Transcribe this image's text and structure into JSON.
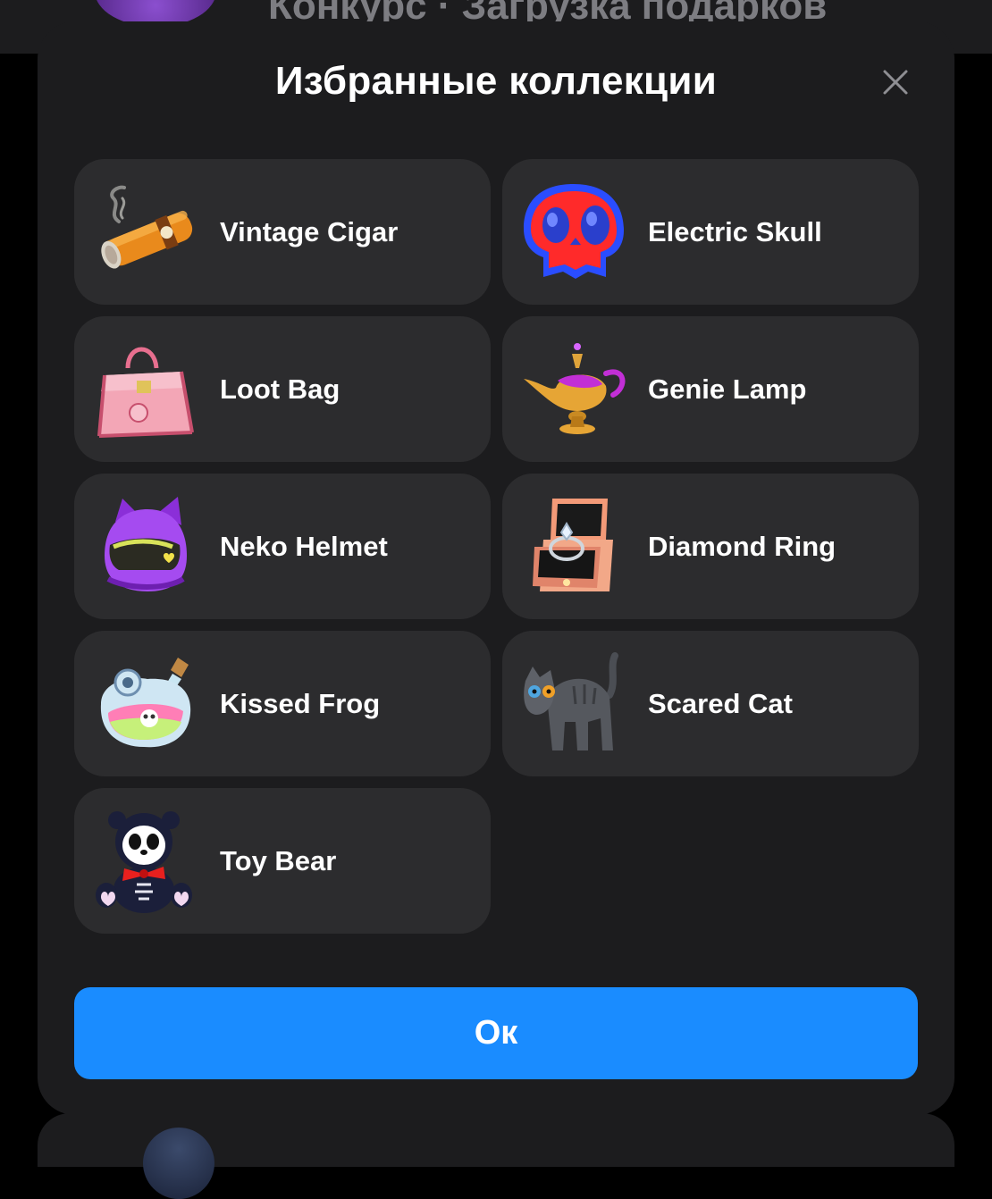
{
  "background": {
    "header_text": "Конкурс · Загрузка подарков"
  },
  "modal": {
    "title": "Избранные коллекции",
    "close_icon": "close-icon",
    "ok_label": "Ок"
  },
  "collections": [
    {
      "label": "Vintage Cigar",
      "icon": "vintage-cigar-icon"
    },
    {
      "label": "Electric Skull",
      "icon": "electric-skull-icon"
    },
    {
      "label": "Loot Bag",
      "icon": "loot-bag-icon"
    },
    {
      "label": "Genie Lamp",
      "icon": "genie-lamp-icon"
    },
    {
      "label": "Neko Helmet",
      "icon": "neko-helmet-icon"
    },
    {
      "label": "Diamond Ring",
      "icon": "diamond-ring-icon"
    },
    {
      "label": "Kissed Frog",
      "icon": "kissed-frog-icon"
    },
    {
      "label": "Scared Cat",
      "icon": "scared-cat-icon"
    },
    {
      "label": "Toy Bear",
      "icon": "toy-bear-icon"
    }
  ],
  "colors": {
    "modal_bg": "#1c1c1e",
    "card_bg": "#2c2c2e",
    "accent": "#1a8cff",
    "text": "#ffffff"
  }
}
